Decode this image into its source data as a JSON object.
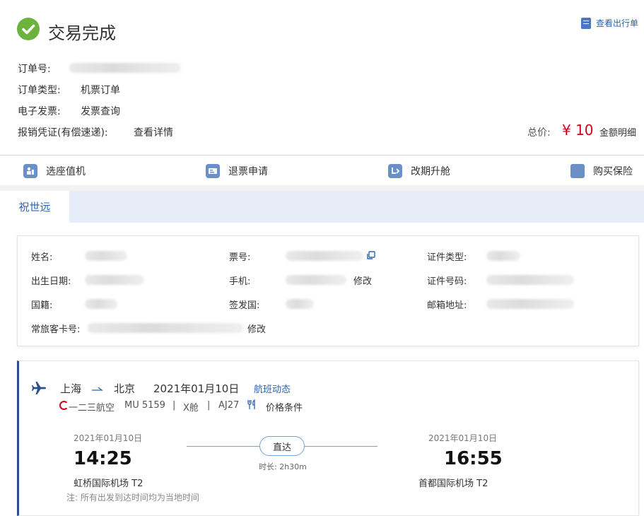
{
  "header": {
    "status_title": "交易完成",
    "view_itinerary": "查看出行单"
  },
  "order": {
    "order_no_label": "订单号:",
    "type_label": "订单类型:",
    "type_value": "机票订单",
    "invoice_label": "电子发票:",
    "invoice_link": "发票查询",
    "voucher_label": "报销凭证(有偿速递):",
    "voucher_link": "查看详情",
    "total_label": "总价:",
    "total_value": "¥ 10",
    "amount_detail": "金额明细"
  },
  "actions": [
    {
      "label": "选座值机",
      "icon": "seat-checkin-icon"
    },
    {
      "label": "退票申请",
      "icon": "refund-icon"
    },
    {
      "label": "改期升舱",
      "icon": "change-upgrade-icon"
    },
    {
      "label": "购买保险",
      "icon": "insurance-icon"
    }
  ],
  "passenger_tab": "祝世远",
  "passenger": {
    "name_label": "姓名:",
    "birth_label": "出生日期:",
    "nationality_label": "国籍:",
    "ffp_label": "常旅客卡号:",
    "ffp_edit": "修改",
    "ticket_label": "票号:",
    "phone_label": "手机:",
    "phone_edit": "修改",
    "issuing_label": "签发国:",
    "idtype_label": "证件类型:",
    "idno_label": "证件号码:",
    "email_label": "邮箱地址:"
  },
  "flight": {
    "from_city": "上海",
    "to_city": "北京",
    "date": "2021年01月10日",
    "status_link": "航班动态",
    "airline": "一二三航空",
    "flight_no": "MU 5159",
    "sep1": "|",
    "cabin": "X舱",
    "sep2": "|",
    "aircraft": "AJ27",
    "price_rules": "价格条件",
    "dep_date": "2021年01月10日",
    "dep_time": "14:25",
    "dep_airport": "虹桥国际机场 T2",
    "arr_date": "2021年01月10日",
    "arr_time": "16:55",
    "arr_airport": "首都国际机场 T2",
    "direct": "直达",
    "duration": "时长: 2h30m",
    "note": "注: 所有出发到达时间均为当地时间"
  },
  "colors": {
    "success": "#6cb33e",
    "link": "#2a64b4",
    "price": "#d0021b",
    "flight_accent": "#2a4f8f"
  }
}
